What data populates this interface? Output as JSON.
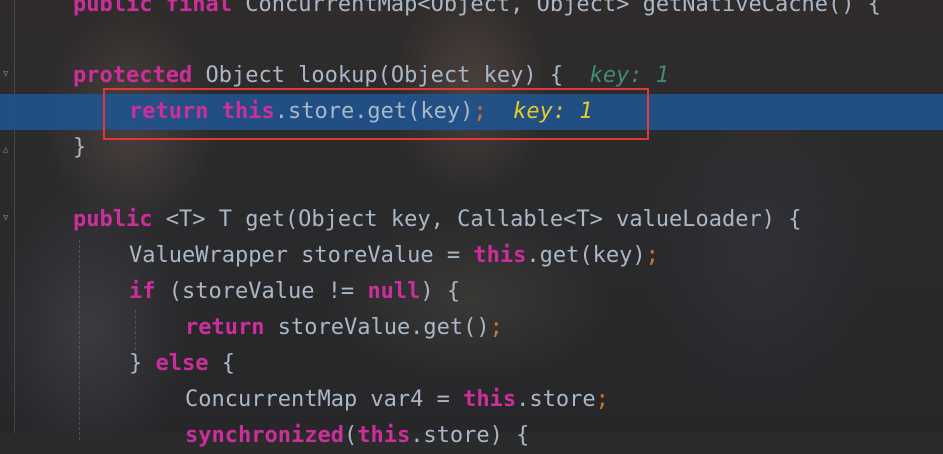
{
  "editor": {
    "accent_color": "#cc2e9b",
    "highlight_color": "#21538c",
    "annotation_box_color": "#e0393c",
    "lines": {
      "l0": {
        "kw1": "public",
        "kw2": "final",
        "rest": "ConcurrentMap<Object, Object> getNativeCache() {"
      },
      "l1": {
        "kw": "protected",
        "rest": "Object lookup(Object key) {",
        "inlay": "key: 1"
      },
      "l2": {
        "kw1": "return",
        "kw2": "this",
        "rest": ".store.get(key)",
        "semi": ";",
        "inlay": "key: 1"
      },
      "l3": {
        "text": "}"
      },
      "l5": {
        "kw": "public",
        "rest": "<T> T get(Object key, Callable<T> valueLoader) {"
      },
      "l6": {
        "pre": "ValueWrapper storeValue = ",
        "kw": "this",
        "rest": ".get(key)",
        "semi": ";"
      },
      "l7": {
        "kw1": "if",
        "mid": "(storeValue != ",
        "kw2": "null",
        "rest": ") {"
      },
      "l8": {
        "kw": "return",
        "rest": "storeValue.get()",
        "semi": ";"
      },
      "l9": {
        "pre": "} ",
        "kw": "else",
        "rest": "{"
      },
      "l10": {
        "pre": "ConcurrentMap var4 = ",
        "kw": "this",
        "rest": ".store",
        "semi": ";"
      },
      "l11": {
        "kw1": "synchronized",
        "pre": "(",
        "kw2": "this",
        "rest": ".store) {"
      }
    }
  }
}
